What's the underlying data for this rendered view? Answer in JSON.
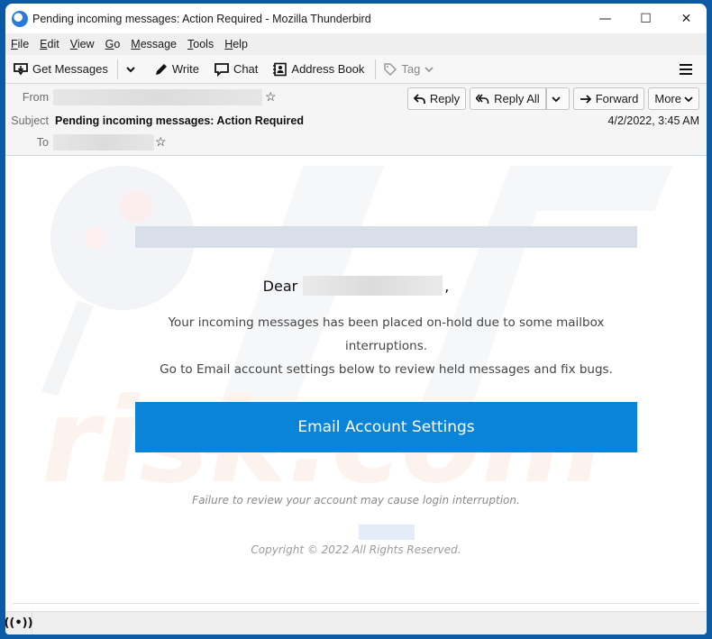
{
  "window": {
    "title": "Pending incoming messages: Action Required - Mozilla Thunderbird",
    "controls": {
      "minimize": "—",
      "maximize": "☐",
      "close": "✕"
    }
  },
  "menubar": {
    "items": [
      {
        "label": "File",
        "accel": "F",
        "rest": "ile"
      },
      {
        "label": "Edit",
        "accel": "E",
        "rest": "dit"
      },
      {
        "label": "View",
        "accel": "V",
        "rest": "iew"
      },
      {
        "label": "Go",
        "accel": "G",
        "rest": "o"
      },
      {
        "label": "Message",
        "accel": "M",
        "rest": "essage"
      },
      {
        "label": "Tools",
        "accel": "T",
        "rest": "ools"
      },
      {
        "label": "Help",
        "accel": "H",
        "rest": "elp"
      }
    ]
  },
  "toolbar": {
    "get_messages": "Get Messages",
    "write": "Write",
    "chat": "Chat",
    "address_book": "Address Book",
    "tag": "Tag"
  },
  "header": {
    "from_label": "From",
    "subject_label": "Subject",
    "to_label": "To",
    "subject": "Pending incoming messages: Action Required",
    "date": "4/2/2022, 3:45 AM",
    "buttons": {
      "reply": "Reply",
      "reply_all": "Reply All",
      "forward": "Forward",
      "more": "More"
    }
  },
  "email": {
    "greeting": "Dear",
    "greeting_suffix": ",",
    "paragraph1": "Your incoming messages has been placed on-hold due to some mailbox interruptions.",
    "paragraph2": "Go to Email account settings below to review held messages and fix bugs.",
    "cta_label": "Email Account Settings",
    "warning": "Failure to review your account may cause login interruption.",
    "copyright": "Copyright © 2022 All Rights Reserved.",
    "colors": {
      "cta": "#0a84d8",
      "banner": "#d8dfe8"
    }
  },
  "statusbar": {
    "icon": "online-status-icon"
  }
}
